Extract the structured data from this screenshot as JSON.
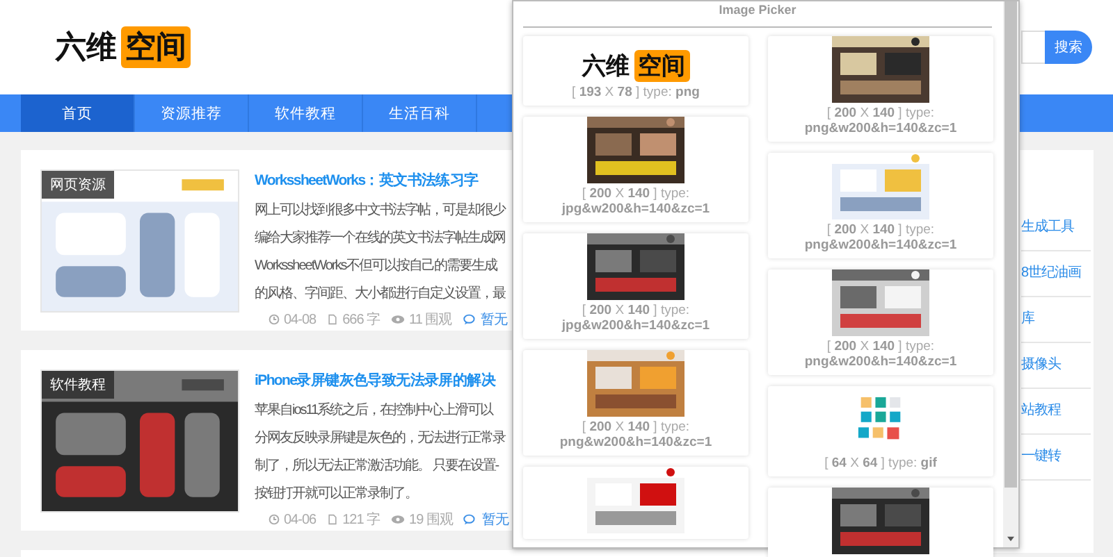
{
  "header": {
    "logo": {
      "text": "六维",
      "highlight": "空间"
    },
    "search_button": "搜索"
  },
  "nav": [
    {
      "label": "首页",
      "selected": true
    },
    {
      "label": "资源推荐",
      "selected": false
    },
    {
      "label": "软件教程",
      "selected": false
    },
    {
      "label": "生活百科",
      "selected": false
    }
  ],
  "articles": [
    {
      "category": "网页资源",
      "title": "WorkssheetWorks：英文书法练习字",
      "lines": [
        "网上可以找到很多中文书法字帖，可是却很少",
        "编给大家推荐一个在线的英文书法字帖生成网",
        "WorkssheetWorks不但可以按自己的需要生成",
        "的风格、字间距、大小都进行自定义设置，最"
      ],
      "date": "04-08",
      "words": "666 字",
      "views": "11 围观",
      "comments": "暂无"
    },
    {
      "category": "软件教程",
      "title": "iPhone录屏键灰色导致无法录屏的解决",
      "lines": [
        "苹果自ios11系统之后，在控制中心上滑可以",
        "分网友反映录屏键是灰色的，无法进行正常录",
        "制了，所以无法正常激活功能。 只要在设置-",
        "按钮打开就可以正常录制了。"
      ],
      "date": "04-06",
      "words": "121 字",
      "views": "19 围观",
      "comments": "暂无"
    }
  ],
  "sidebar": {
    "items": [
      "生成工具",
      "8世纪油画",
      "库",
      "摄像头",
      "站教程",
      "一键转"
    ]
  },
  "picker": {
    "title": "Image Picker",
    "columns": [
      [
        {
          "kind": "logo",
          "logo_text": "六维",
          "logo_highlight": "空间",
          "caption": "[ **193** X **78** ] type: **png**"
        },
        {
          "kind": "picture",
          "caption": "[ **200** X **140** ] type: **jpg&w200&h=140&zc=1**"
        },
        {
          "kind": "picture",
          "caption": "[ **200** X **140** ] type: **jpg&w200&h=140&zc=1**"
        },
        {
          "kind": "picture",
          "caption": "[ **200** X **140** ] type: **png&w200&h=140&zc=1**"
        },
        {
          "kind": "picture"
        }
      ],
      [
        {
          "kind": "picture",
          "caption": "[ **200** X **140** ] type: **png&w200&h=140&zc=1**"
        },
        {
          "kind": "picture",
          "caption": "[ **200** X **140** ] type: **png&w200&h=140&zc=1**"
        },
        {
          "kind": "picture",
          "caption": "[ **200** X **140** ] type: **png&w200&h=140&zc=1**"
        },
        {
          "kind": "tiles",
          "caption": "[ **64** X **64** ] type: **gif**"
        },
        {
          "kind": "picture"
        }
      ]
    ]
  }
}
